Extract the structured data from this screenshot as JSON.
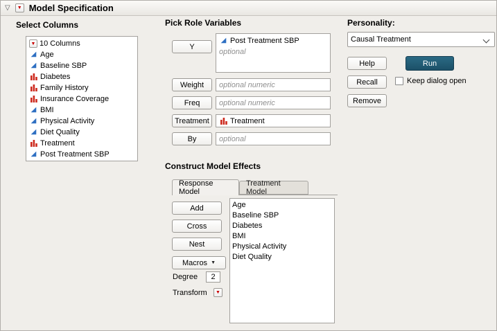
{
  "window": {
    "title": "Model Specification"
  },
  "icons": {
    "disclosure": "▽",
    "red_triangle": "▼",
    "continuous": "◢",
    "macros_caret": "▼"
  },
  "select_columns": {
    "label": "Select Columns",
    "count_header": "10 Columns",
    "items": [
      {
        "label": "Age",
        "type": "continuous"
      },
      {
        "label": "Baseline SBP",
        "type": "continuous"
      },
      {
        "label": "Diabetes",
        "type": "nominal"
      },
      {
        "label": "Family History",
        "type": "nominal"
      },
      {
        "label": "Insurance Coverage",
        "type": "nominal"
      },
      {
        "label": "BMI",
        "type": "continuous"
      },
      {
        "label": "Physical Activity",
        "type": "continuous"
      },
      {
        "label": "Diet Quality",
        "type": "continuous"
      },
      {
        "label": "Treatment",
        "type": "nominal"
      },
      {
        "label": "Post Treatment SBP",
        "type": "continuous"
      }
    ]
  },
  "pick_role_variables": {
    "label": "Pick Role Variables",
    "y_button": "Y",
    "y_value": "Post Treatment SBP",
    "y_placeholder": "optional",
    "weight_button": "Weight",
    "weight_placeholder": "optional numeric",
    "freq_button": "Freq",
    "freq_placeholder": "optional numeric",
    "treatment_button": "Treatment",
    "treatment_value": "Treatment",
    "by_button": "By",
    "by_placeholder": "optional"
  },
  "construct_model_effects": {
    "label": "Construct Model Effects",
    "tabs": [
      {
        "label": "Response Model"
      },
      {
        "label": "Treatment Model"
      }
    ],
    "add_button": "Add",
    "cross_button": "Cross",
    "nest_button": "Nest",
    "macros_button": "Macros",
    "degree_label": "Degree",
    "degree_value": "2",
    "transform_label": "Transform",
    "effects": [
      "Age",
      "Baseline SBP",
      "Diabetes",
      "BMI",
      "Physical Activity",
      "Diet Quality"
    ]
  },
  "personality": {
    "label": "Personality:",
    "selected": "Causal Treatment",
    "help_button": "Help",
    "run_button": "Run",
    "recall_button": "Recall",
    "keep_dialog_open_label": "Keep dialog open",
    "remove_button": "Remove"
  },
  "colors": {
    "run_button_bg": "#1c5068",
    "continuous_icon": "#2e6fc2",
    "nominal_icon": "#cd2a1e",
    "red_triangle": "#c90000"
  }
}
